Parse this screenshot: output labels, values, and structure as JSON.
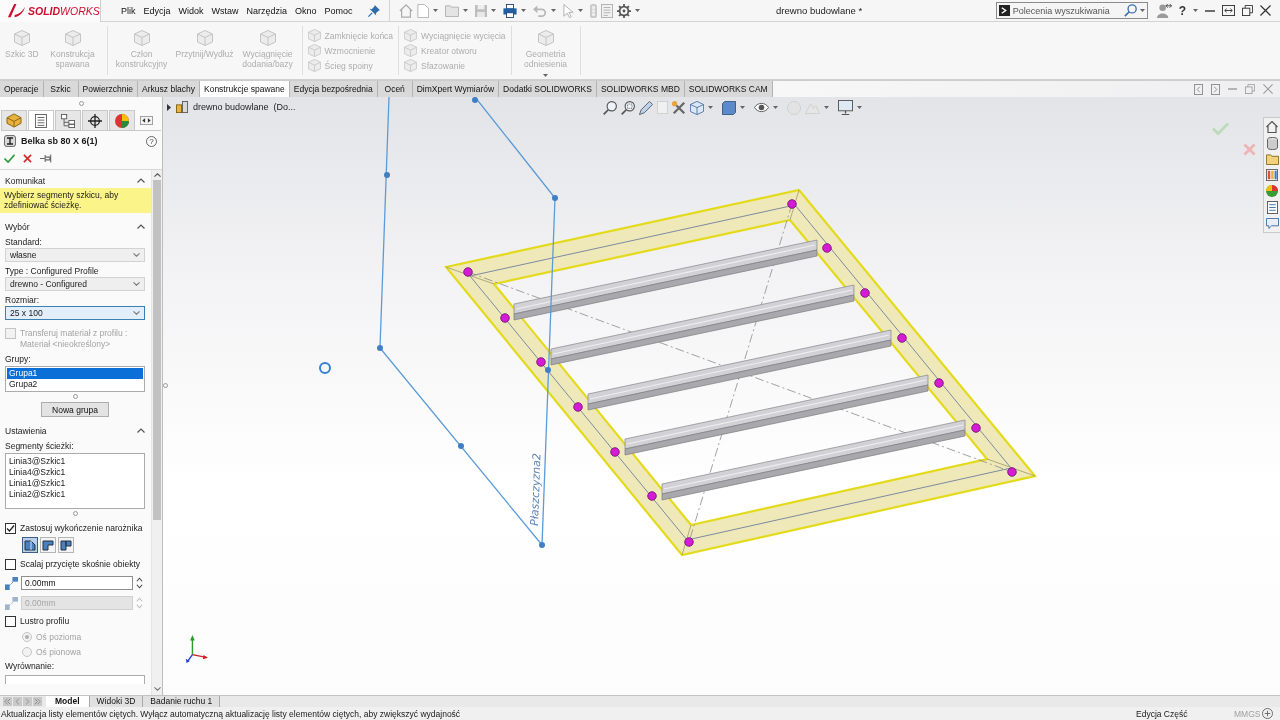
{
  "title_bar": {
    "logo": "**SOLID**WORKS",
    "menu": [
      "Plik",
      "Edycja",
      "Widok",
      "Wstaw",
      "Narzędzia",
      "Okno",
      "Pomoc"
    ],
    "title": "drewno budowlane *",
    "search": {
      "placeholder": "Polecenia wyszukiwania"
    },
    "help": "?"
  },
  "ribbon": {
    "groups": [
      {
        "kind": "large",
        "items": [
          {
            "label": "Szkic 3D",
            "disabled": true
          },
          {
            "label": "Konstrukcja spawana",
            "disabled": true
          }
        ]
      },
      {
        "kind": "large",
        "items": [
          {
            "label": "Człon konstrukcyjny",
            "disabled": true
          },
          {
            "label": "Przytnij/Wydłuż",
            "disabled": true
          },
          {
            "label": "Wyciągnięcie dodania/bazy",
            "disabled": true
          }
        ]
      },
      {
        "kind": "small",
        "items": [
          {
            "label": "Zamknięcie końca",
            "disabled": true
          },
          {
            "label": "Wzmocnienie",
            "disabled": true
          },
          {
            "label": "Ścieg spoiny",
            "disabled": true
          }
        ]
      },
      {
        "kind": "small",
        "items": [
          {
            "label": "Wyciągnięcie wycięcia",
            "disabled": true
          },
          {
            "label": "Kreator otworu",
            "disabled": true
          },
          {
            "label": "Sfazowanie",
            "disabled": true
          }
        ]
      },
      {
        "kind": "large",
        "items": [
          {
            "label": "Geometria odniesienia",
            "disabled": true
          }
        ]
      }
    ]
  },
  "tabs": [
    {
      "label": "Operacje",
      "selected": false
    },
    {
      "label": "Szkic",
      "selected": false
    },
    {
      "label": "Powierzchnie",
      "selected": false
    },
    {
      "label": "Arkusz blachy",
      "selected": false
    },
    {
      "label": "Konstrukcje spawane",
      "selected": true
    },
    {
      "label": "Edycja bezpośrednia",
      "selected": false
    },
    {
      "label": "Oceń",
      "selected": false
    },
    {
      "label": "DimXpert Wymiarów",
      "selected": false
    },
    {
      "label": "Dodatki SOLIDWORKS",
      "selected": false
    },
    {
      "label": "SOLIDWORKS MBD",
      "selected": false
    },
    {
      "label": "SOLIDWORKS CAM",
      "selected": false
    }
  ],
  "property_manager": {
    "panel_tabs": [
      {
        "kind": "tree",
        "selected": false
      },
      {
        "kind": "properties",
        "selected": true
      },
      {
        "kind": "configurations",
        "selected": false
      },
      {
        "kind": "dimxpert",
        "selected": false
      },
      {
        "kind": "display",
        "selected": false
      }
    ],
    "title": "Belka sb 80 X 6(1)",
    "help": "?",
    "message": {
      "heading": "Komunikat",
      "text": "Wybierz segmenty szkicu, aby zdefiniować ścieżkę."
    },
    "selection": {
      "heading": "Wybór",
      "dropdowns": [
        {
          "label": "Standard:",
          "value": "własne",
          "focused": false
        },
        {
          "label": "Type : Configured Profile",
          "value": "drewno - Configured",
          "focused": false
        },
        {
          "label": "Rozmiar:",
          "value": "25 x 100",
          "focused": true
        }
      ],
      "transfer_material": {
        "label": "Transferuj materiał z profilu : Materiał <nieokreślony>",
        "checked": false,
        "disabled": true
      },
      "groups_label": "Grupy:",
      "groups": [
        {
          "label": "Grupa1",
          "selected": true
        },
        {
          "label": "Grupa2",
          "selected": false
        }
      ],
      "new_group_button": "Nowa grupa"
    },
    "settings": {
      "heading": "Ustawienia",
      "segments_label": "Segmenty ścieżki:",
      "segments": [
        "Linia3@Szkic1",
        "Linia4@Szkic1",
        "Linia1@Szkic1",
        "Linia2@Szkic1"
      ],
      "corner_treatment": {
        "label": "Zastosuj wykończenie narożnika",
        "checked": true
      },
      "corner_options": [
        {
          "selected": true
        },
        {
          "selected": false
        },
        {
          "selected": false
        }
      ],
      "merge_miter": {
        "label": "Scalaj przycięte skośnie obiekty",
        "checked": false
      },
      "gaps": [
        {
          "value": "0.00mm",
          "disabled": false
        },
        {
          "value": "0.00mm",
          "disabled": true
        }
      ],
      "mirror_profile": {
        "label": "Lustro profilu",
        "checked": false
      },
      "mirror_axes": [
        {
          "label": "Oś pozioma",
          "selected": true,
          "disabled": true
        },
        {
          "label": "Oś pionowa",
          "selected": false,
          "disabled": true
        }
      ],
      "alignment_label": "Wyrównanie:"
    }
  },
  "viewport": {
    "tree_item": "drewno budowlane  (Do...",
    "plane_label": "Płaszczyzna2"
  },
  "bottom_tabs": [
    {
      "label": "Model",
      "selected": true
    },
    {
      "label": "Widoki 3D",
      "selected": false
    },
    {
      "label": "Badanie ruchu 1",
      "selected": false
    }
  ],
  "status_bar": {
    "message": "Aktualizacja listy elementów ciętych. Wyłącz automatyczną aktualizację listy elementów ciętych, aby zwiększyć wydajność",
    "mode": "Edycja Część",
    "units": "MMGS"
  }
}
